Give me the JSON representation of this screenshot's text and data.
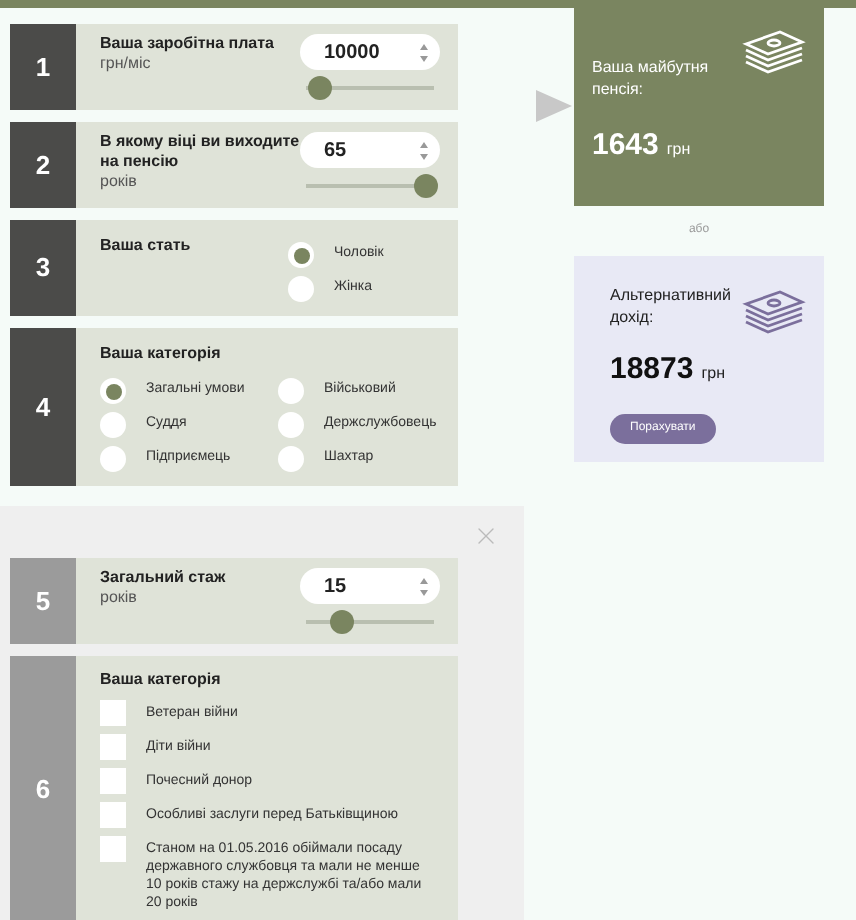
{
  "sections": [
    {
      "number": "1",
      "kind": "input",
      "label": "Ваша заробітна плата",
      "unit": "грн/міс",
      "value": "10000",
      "level": 0.05
    },
    {
      "number": "2",
      "kind": "input",
      "label": "В якому віці ви виходите на пенсію",
      "unit": "років",
      "value": "65",
      "level": 1
    },
    {
      "number": "3",
      "kind": "radio",
      "label": "Ваша стать",
      "options": [
        {
          "label": "Чоловік",
          "selected": true
        },
        {
          "label": "Жінка",
          "selected": false
        }
      ]
    },
    {
      "number": "4",
      "kind": "radio-grid",
      "label": "Ваша категорія",
      "options": [
        {
          "label": "Загальні умови",
          "selected": true
        },
        {
          "label": "Військовий",
          "selected": false
        },
        {
          "label": "Суддя",
          "selected": false
        },
        {
          "label": "Держслужбовець",
          "selected": false
        },
        {
          "label": "Підприємець",
          "selected": false
        },
        {
          "label": "Шахтар",
          "selected": false
        }
      ]
    }
  ],
  "pension": {
    "label": "Ваша майбутня пенсія:",
    "amount": "1643",
    "unit": "грн"
  },
  "separator": "або",
  "alternative": {
    "label": "Альтернативний дохід:",
    "amount": "18873",
    "unit": "грн",
    "button": "Порахувати"
  },
  "modal": {
    "sections": [
      {
        "number": "5",
        "kind": "input",
        "label": "Загальний стаж",
        "unit": "років",
        "value": "15",
        "level": 0.25
      },
      {
        "number": "6",
        "kind": "checkbox",
        "label": "Ваша категорія",
        "options": [
          {
            "label": "Ветеран війни",
            "checked": false
          },
          {
            "label": "Діти війни",
            "checked": false
          },
          {
            "label": "Почесний донор",
            "checked": false
          },
          {
            "label": "Особливі заслуги перед Батьківщиною",
            "checked": false
          },
          {
            "label": "Станом на 01.05.2016 обіймали посаду державного службовця та мали не менше 10 років стажу на держслужбі та/або мали 20 років",
            "checked": false
          }
        ]
      }
    ]
  }
}
